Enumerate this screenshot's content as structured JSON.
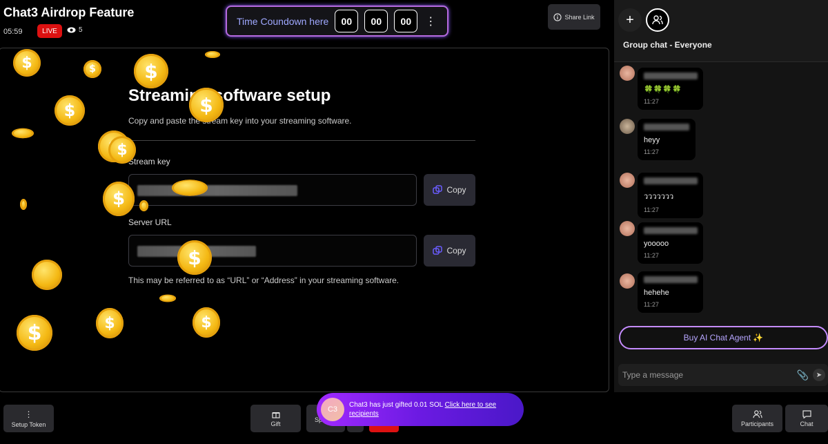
{
  "header": {
    "title": "Chat3 Airdrop Feature",
    "elapsed": "05:59",
    "live_label": "LIVE",
    "viewer_count": "5"
  },
  "countdown": {
    "label": "Time Coundown here",
    "hours": "00",
    "minutes": "00",
    "seconds": "00"
  },
  "share_link_label": "Share Link",
  "setup": {
    "title": "Streaming software setup",
    "subtitle": "Copy and paste the stream key into your streaming software.",
    "stream_key_label": "Stream key",
    "server_url_label": "Server URL",
    "copy_label": "Copy",
    "hint": "This may be referred to as “URL” or “Address” in your streaming software."
  },
  "chat": {
    "group_title": "Group chat - Everyone",
    "messages": [
      {
        "text": "🍀🍀🍀🍀",
        "time": "11:27"
      },
      {
        "text": "heyy",
        "time": "11:27"
      },
      {
        "text": "ววววววว",
        "time": "11:27"
      },
      {
        "text": "yooooo",
        "time": "11:27"
      },
      {
        "text": "hehehe",
        "time": "11:27"
      }
    ],
    "buy_ai_label": "Buy AI Chat Agent ✨",
    "input_placeholder": "Type a message"
  },
  "bottom": {
    "setup_token": "Setup Token",
    "gift": "Gift",
    "spe": "Spe",
    "participants": "Participants",
    "chat": "Chat"
  },
  "toast": {
    "avatar": "C3",
    "text": "Chat3 has just gifted 0.01 SOL ",
    "link": "Click here to see recipients"
  },
  "colors": {
    "live": "#dd1111",
    "accent_purple": "#b66adf",
    "toast_gradient_start": "#a12aff",
    "coin_gold": "#f4b813"
  }
}
